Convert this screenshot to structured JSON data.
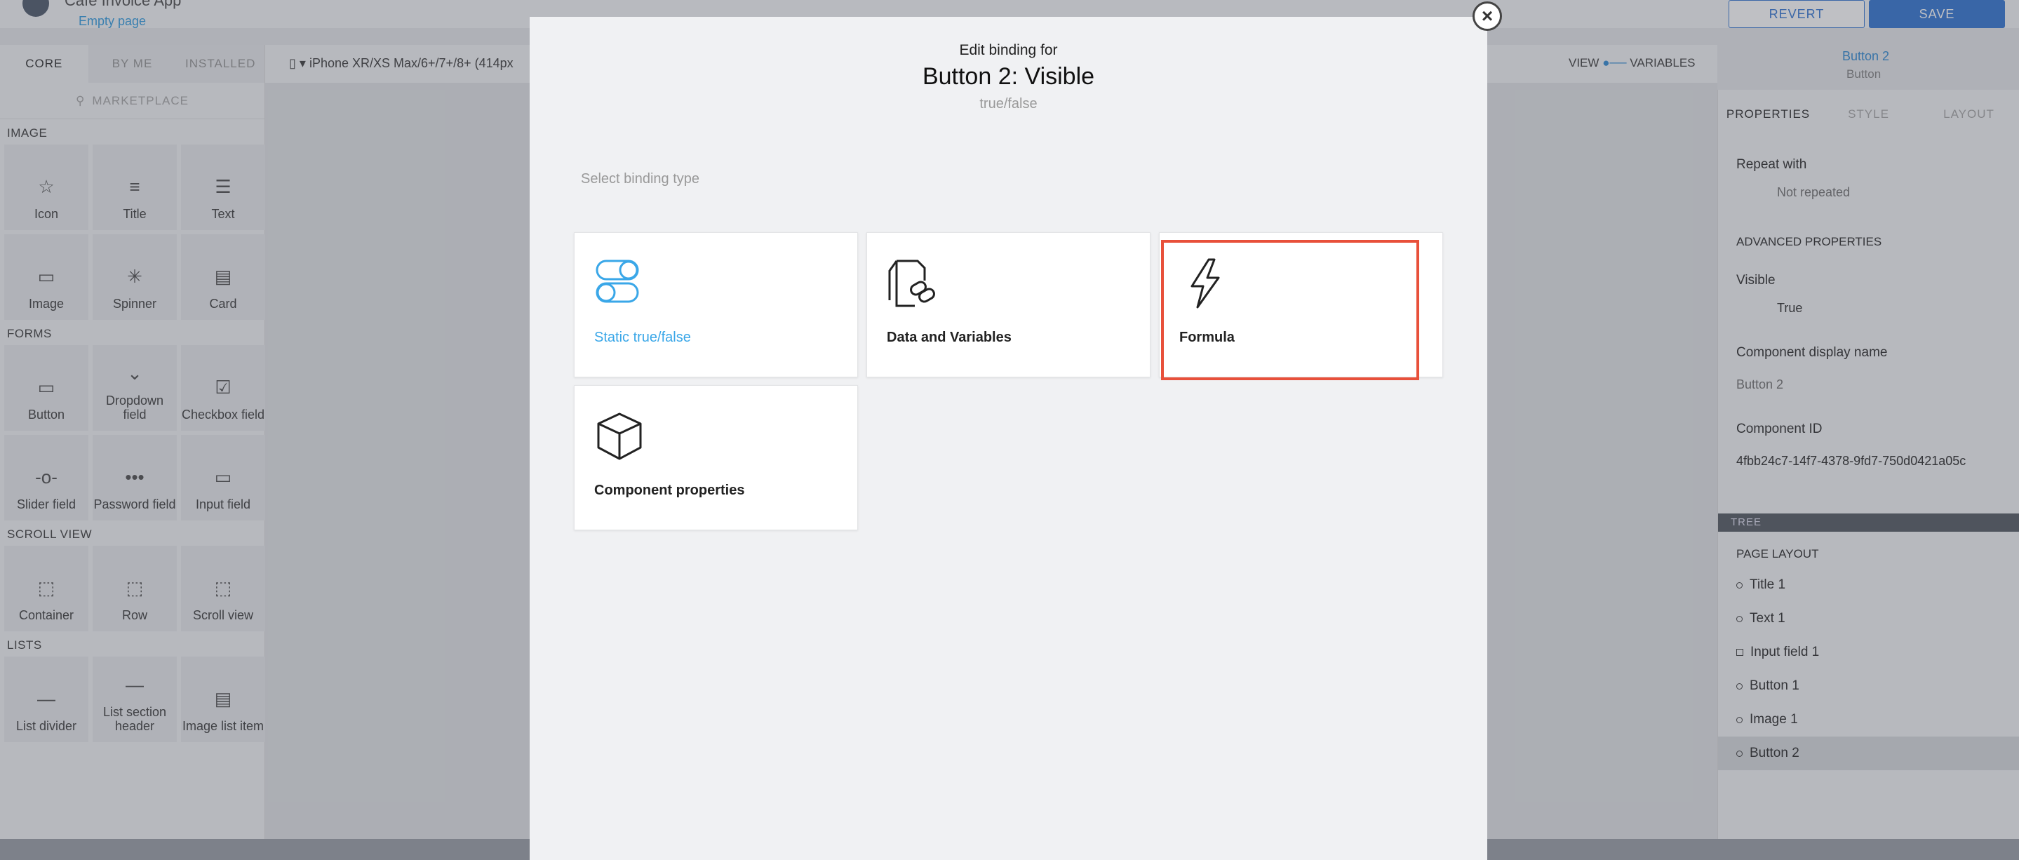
{
  "app": {
    "title": "Cafe Invoice App",
    "page": "Empty page"
  },
  "header": {
    "revert_label": "REVERT",
    "save_label": "SAVE"
  },
  "left_panel": {
    "tabs": [
      "CORE",
      "BY ME",
      "INSTALLED"
    ],
    "marketplace_label": "MARKETPLACE",
    "sections": [
      {
        "title": "IMAGE",
        "items": [
          "Icon",
          "Title",
          "Text",
          "Image",
          "Spinner",
          "Card"
        ]
      },
      {
        "title": "FORMS",
        "items": [
          "Button",
          "Dropdown field",
          "Checkbox field",
          "Slider field",
          "Password field",
          "Input field"
        ]
      },
      {
        "title": "SCROLL VIEW",
        "items": [
          "Container",
          "Row",
          "Scroll view"
        ]
      },
      {
        "title": "LISTS",
        "items": [
          "List divider",
          "List section header",
          "Image list item"
        ]
      }
    ]
  },
  "device": {
    "label": "iPhone XR/XS Max/6+/7+/8+ (414px"
  },
  "view_toggle": {
    "view": "VIEW",
    "variables": "VARIABLES"
  },
  "selected": {
    "name": "Button 2",
    "type": "Button"
  },
  "right_panel": {
    "tabs": [
      "PROPERTIES",
      "STYLE",
      "LAYOUT"
    ],
    "repeat_label": "Repeat with",
    "repeat_value": "Not repeated",
    "advanced_label": "ADVANCED PROPERTIES",
    "visible_label": "Visible",
    "visible_value": "True",
    "display_name_label": "Component display name",
    "display_name_value": "Button 2",
    "component_id_label": "Component ID",
    "component_id_value": "4fbb24c7-14f7-4378-9fd7-750d0421a05c",
    "tree_label": "TREE",
    "page_layout_label": "PAGE LAYOUT",
    "tree_items": [
      "Title 1",
      "Text 1",
      "Input field 1",
      "Button 1",
      "Image 1",
      "Button 2"
    ]
  },
  "modal": {
    "edit_for": "Edit binding for",
    "title": "Button 2: Visible",
    "subtitle": "true/false",
    "select_type": "Select binding type",
    "cards": [
      {
        "label": "Static true/false",
        "icon": "toggle-icon"
      },
      {
        "label": "Data and Variables",
        "icon": "data-link-icon"
      },
      {
        "label": "Formula",
        "icon": "lightning-icon"
      },
      {
        "label": "Component properties",
        "icon": "cube-icon"
      }
    ],
    "close_symbol": "×"
  },
  "colors": {
    "accent": "#3a7bd5",
    "link": "#3aa7e8",
    "highlight": "#e8503a"
  }
}
